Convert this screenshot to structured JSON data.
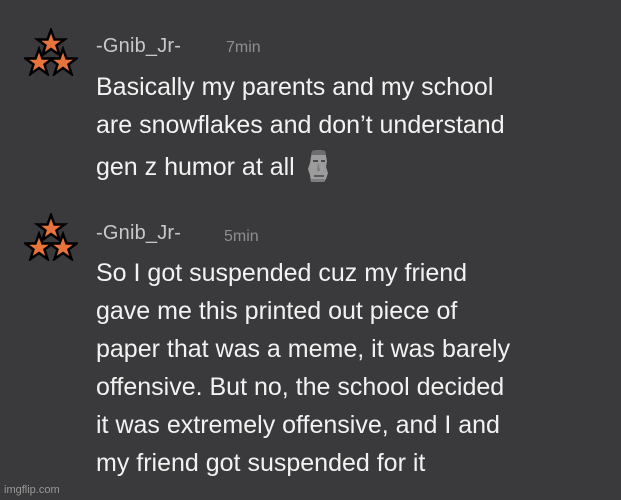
{
  "messages": [
    {
      "username": "-Gnib_Jr-",
      "timestamp": "7min",
      "avatar_icon": "three-stars-icon",
      "lines": [
        "Basically my parents and my school",
        "are snowflakes and don’t understand",
        "gen z humor at all"
      ],
      "emoji": "moai-icon"
    },
    {
      "username": "-Gnib_Jr-",
      "timestamp": "5min",
      "avatar_icon": "three-stars-icon",
      "lines": [
        "So I got suspended cuz my friend",
        "gave me this printed out piece of",
        "paper that was a meme, it was barely",
        "offensive. But no, the school decided",
        "it was extremely offensive, and I and",
        "my friend got suspended for it"
      ]
    }
  ],
  "watermark": "imgflip.com",
  "colors": {
    "background": "#3a3a3c",
    "text": "#f2f2f2",
    "username": "#c8c8c8",
    "timestamp": "#8e8e8e",
    "star_fill": "#e8743b"
  }
}
